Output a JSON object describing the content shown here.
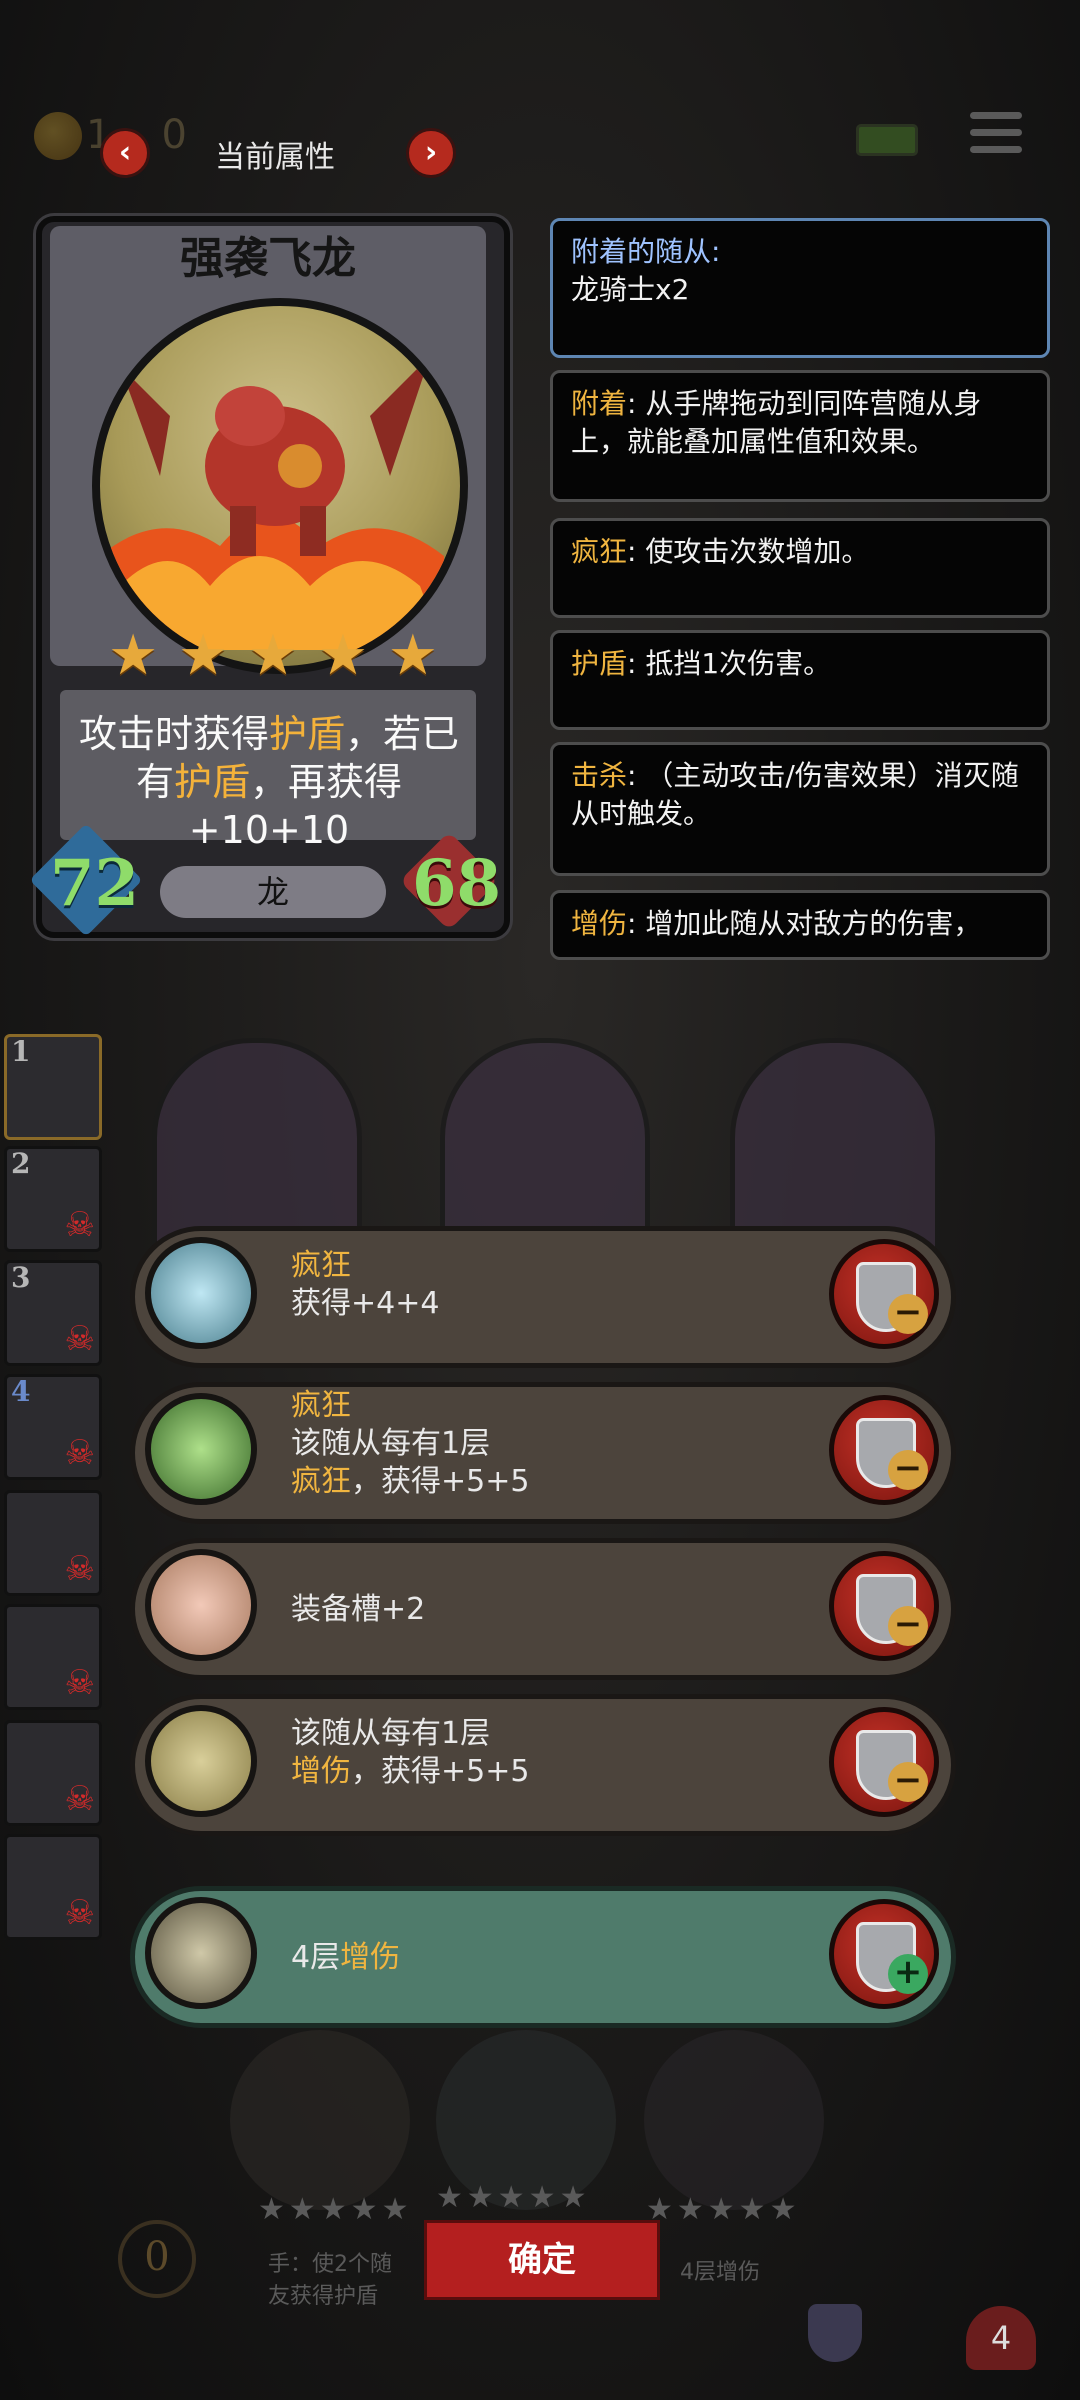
{
  "topbar": {
    "coin_text": "1",
    "coin_text_tail": "0",
    "title": "当前属性",
    "prev_icon": "‹",
    "next_icon": "›"
  },
  "card": {
    "name": "强袭飞龙",
    "stars": 5,
    "desc_pre": "攻击时获得",
    "desc_kw1": "护盾",
    "desc_mid": "，若已",
    "desc_pre2": "有",
    "desc_kw2": "护盾",
    "desc_post": "，再获得+10+10",
    "attack": "72",
    "health": "68",
    "race": "龙"
  },
  "panels": [
    {
      "title": "附着的随从:",
      "body": "龙骑士x2"
    },
    {
      "kw": "附着",
      "body": ": 从手牌拖动到同阵营随从身上，就能叠加属性值和效果。"
    },
    {
      "kw": "疯狂",
      "body": ": 使攻击次数增加。"
    },
    {
      "kw": "护盾",
      "body": ": 抵挡1次伤害。"
    },
    {
      "kw": "击杀",
      "body": ": （主动攻击/伤害效果）消灭随从时触发。"
    },
    {
      "kw": "增伤",
      "body": ": 增加此随从对敌方的伤害，"
    }
  ],
  "slots": [
    "1",
    "2",
    "3",
    "4",
    "",
    "",
    "",
    ""
  ],
  "options": [
    {
      "line1_kw": "疯狂",
      "line2": "获得+4+4",
      "line3_kw": "",
      "line3": "",
      "button": "−"
    },
    {
      "line1_kw": "疯狂",
      "line2": "该随从每有1层",
      "line3_kw": "疯狂",
      "line3": "，获得+5+5",
      "button": "−"
    },
    {
      "line1_kw": "",
      "line2": "装备槽+2",
      "line3_kw": "",
      "line3": "",
      "button": "−"
    },
    {
      "line1_kw": "",
      "line2": "该随从每有1层",
      "line3_kw": "增伤",
      "line3": "，获得+5+5",
      "button": "−"
    }
  ],
  "selected_option": {
    "text_pre": "4层",
    "text_kw": "增伤",
    "button": "+"
  },
  "bottom": {
    "confirm": "确定",
    "left_text1": "手：使2个随",
    "left_text2": "友获得护盾",
    "right_text": "4层增伤",
    "counter": "0",
    "heart": "4"
  },
  "colors": {
    "keyword": "#f0b540",
    "confirm": "#b41f1f",
    "attack": "#8fdc6a"
  }
}
